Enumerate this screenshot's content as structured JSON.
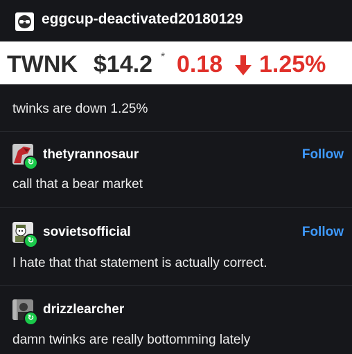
{
  "post": {
    "username": "eggcup-deactivated20180129",
    "avatar_icon": "sunglasses-avatar-icon",
    "banner": {
      "ticker": "TWNK",
      "price": "$14.2",
      "asterisk": "*",
      "change": "0.18",
      "direction_icon": "down-arrow-icon",
      "percent": "1.25%",
      "negative_color": "#e0302a"
    },
    "caption": "twinks are down 1.25%"
  },
  "replies": [
    {
      "username": "thetyrannosaur",
      "text": "call that a bear market",
      "follow_label": "Follow"
    },
    {
      "username": "sovietsofficial",
      "text": "I hate that that statement is actually correct.",
      "follow_label": "Follow"
    },
    {
      "username": "drizzlearcher",
      "text": "damn twinks are really bottomming lately",
      "follow_label": ""
    }
  ],
  "theme": {
    "background": "#16171b",
    "link": "#3f9bff",
    "reblog_badge": "#1ac94a"
  }
}
